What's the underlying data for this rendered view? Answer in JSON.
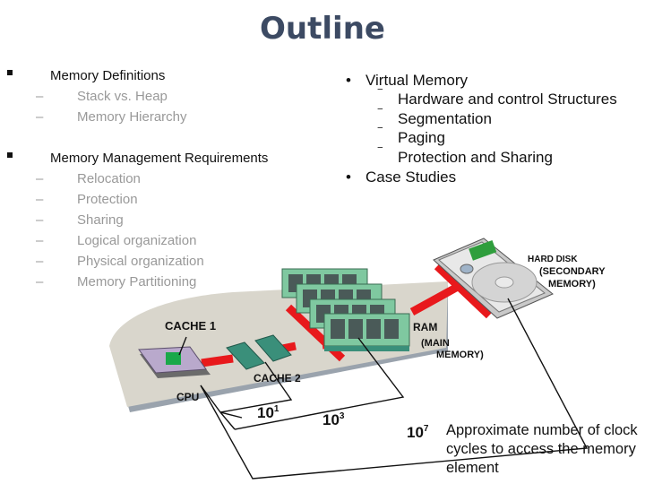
{
  "title": "Outline",
  "left_outline": [
    {
      "label": "Memory Definitions",
      "subitems": [
        "Stack vs. Heap",
        "Memory Hierarchy"
      ]
    },
    {
      "label": "Memory Management Requirements",
      "subitems": [
        "Relocation",
        "Protection",
        "Sharing",
        "Logical organization",
        "Physical organization",
        "Memory Partitioning"
      ]
    }
  ],
  "right_outline": [
    {
      "label": "Virtual Memory",
      "subitems": [
        "Hardware and control Structures",
        "Segmentation",
        "Paging",
        "Protection and Sharing"
      ]
    },
    {
      "label": "Case Studies",
      "subitems": []
    }
  ],
  "bullets": {
    "level1_left": "square",
    "level2_left": "–",
    "level1_right": "•",
    "level2_right": "‾"
  },
  "diagram": {
    "labels": {
      "cache1": "CACHE 1",
      "cache2": "CACHE 2",
      "cpu": "CPU",
      "ram": "RAM",
      "ram_sub1": "(MAIN",
      "ram_sub2": "MEMORY)",
      "hdd": "HARD DISK",
      "hdd_sub1": "(SECONDARY",
      "hdd_sub2": "MEMORY)"
    },
    "access_cycles": [
      {
        "element": "CACHE 2",
        "base": "10",
        "exp": "1"
      },
      {
        "element": "RAM",
        "base": "10",
        "exp": "3"
      },
      {
        "element": "HARD DISK",
        "base": "10",
        "exp": "7"
      }
    ],
    "caption": "Approximate number of clock cycles to access the memory element",
    "colors": {
      "title": "#3c4a63",
      "bus": "#e8191c",
      "board": "#d9d6cc",
      "ram": "#7fc8a0",
      "cache_chip": "#3a8f7a",
      "cpu": "#b9a9cc",
      "cache1": "#1aa84a"
    }
  }
}
